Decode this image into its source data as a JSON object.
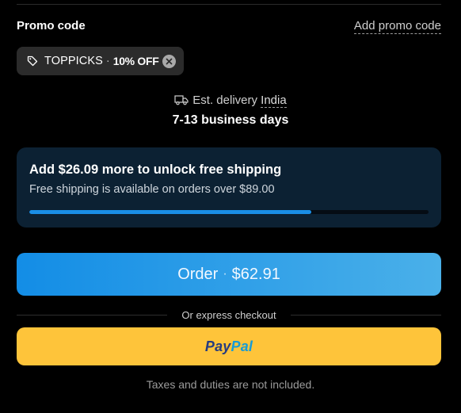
{
  "promo": {
    "label": "Promo code",
    "add_link": "Add promo code",
    "applied_code": "TOPPICKS",
    "separator": "·",
    "discount": "10% OFF"
  },
  "delivery": {
    "prefix": "Est. delivery",
    "country": "India",
    "days": "7-13 business days"
  },
  "shipping": {
    "title": "Add $26.09 more to unlock free shipping",
    "subtitle": "Free shipping is available on orders over $89.00",
    "progress_percent": 70.7
  },
  "order": {
    "label": "Order",
    "separator": "·",
    "total": "$62.91"
  },
  "express": {
    "label": "Or express checkout"
  },
  "paypal": {
    "pay": "Pay",
    "pal": "Pal"
  },
  "footer": {
    "taxes_note": "Taxes and duties are not included."
  },
  "colors": {
    "background": "#000000",
    "shipping_card": "#0c2133",
    "progress": "#1a8ee6",
    "order_gradient_start": "#138de6",
    "order_gradient_end": "#4ab0e9",
    "paypal_button": "#fec43a"
  },
  "icons": [
    "tag-icon",
    "remove-icon",
    "truck-icon"
  ]
}
